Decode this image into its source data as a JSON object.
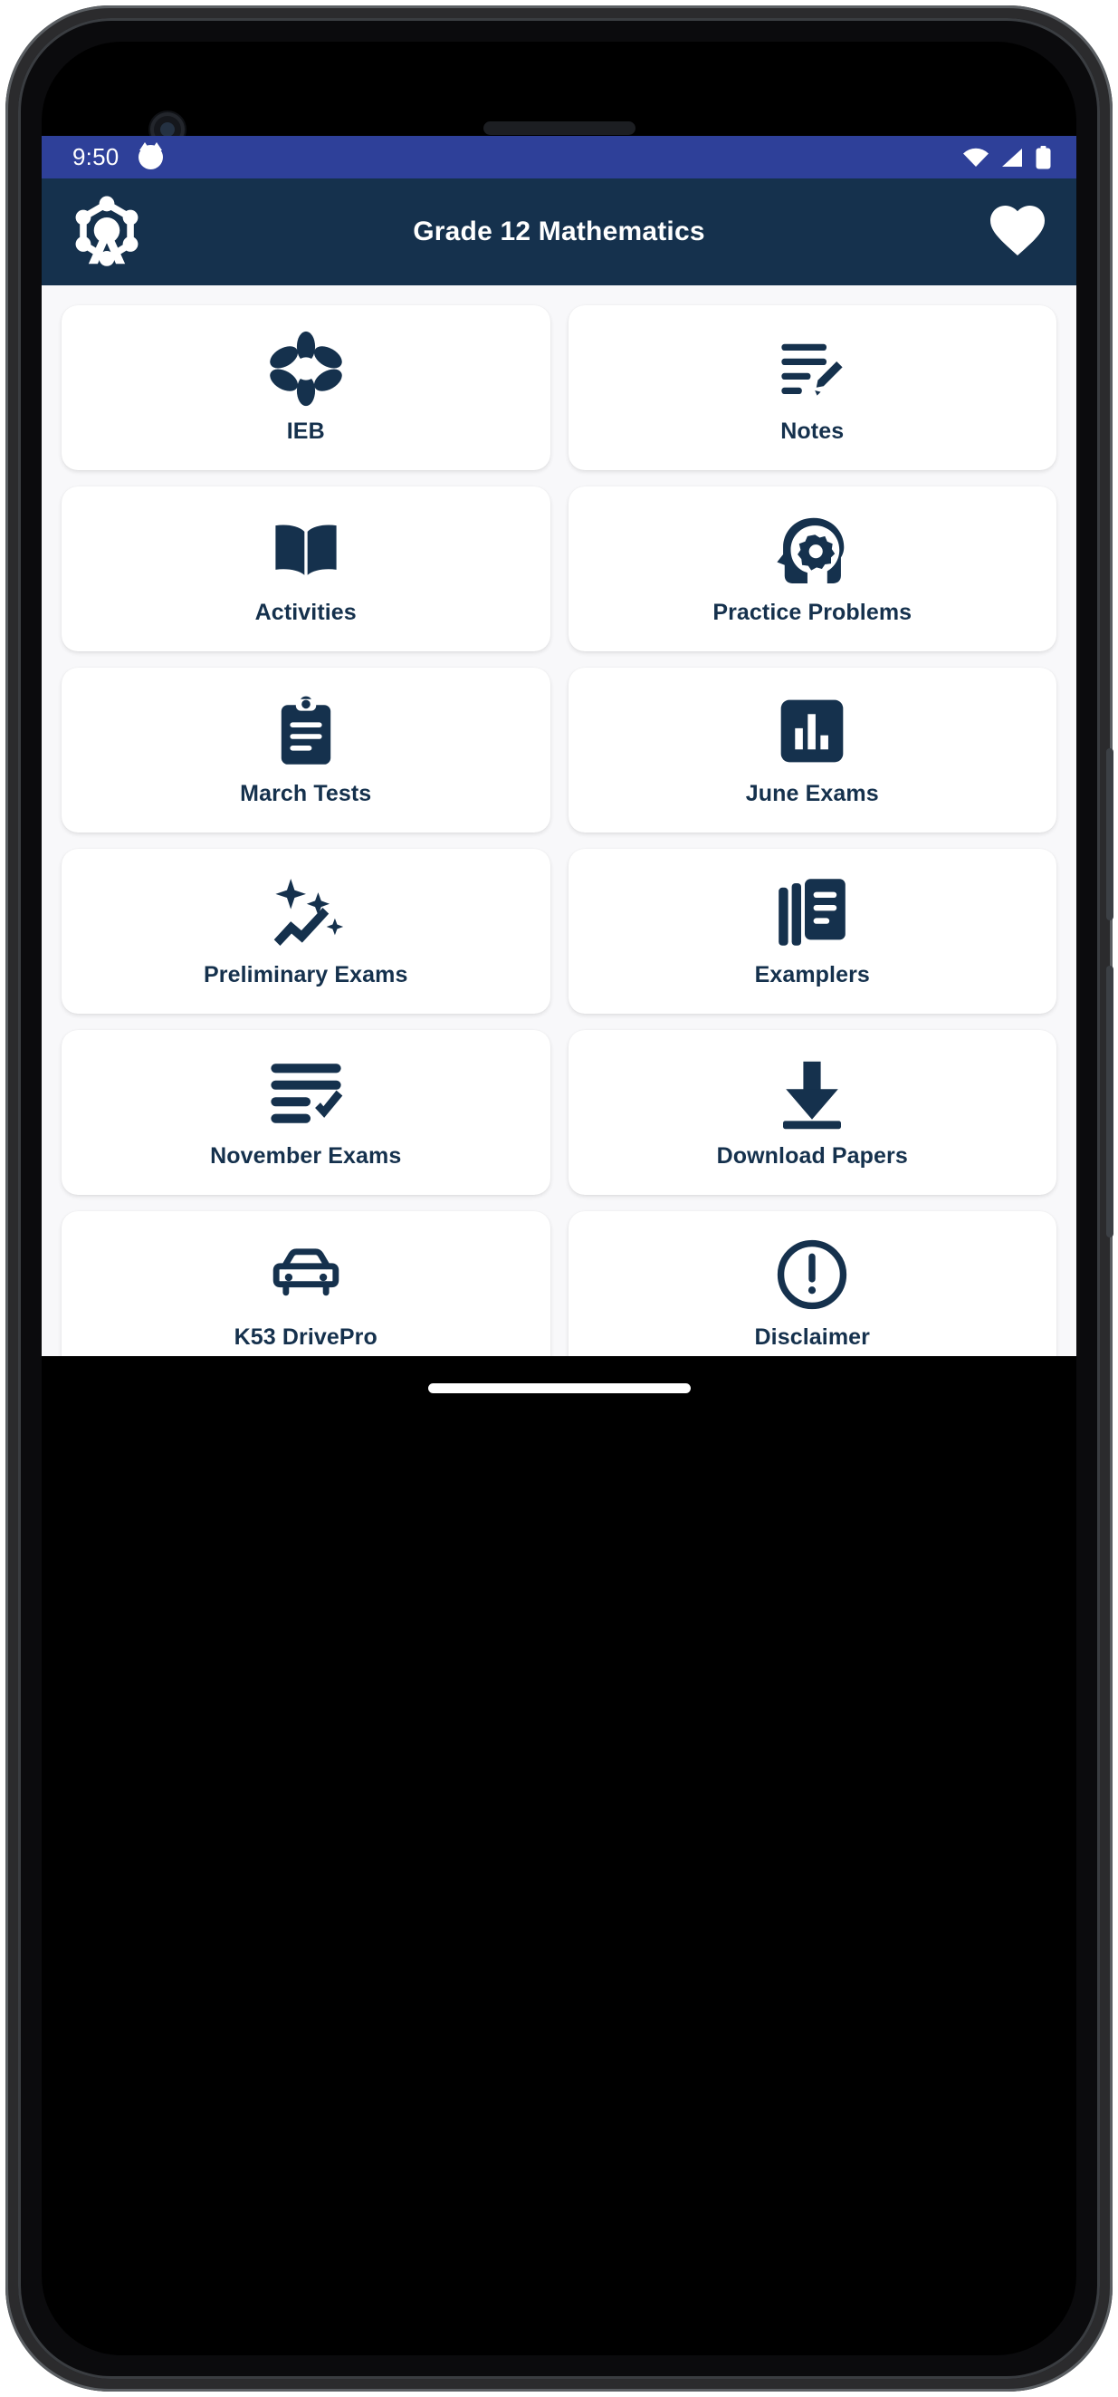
{
  "status_bar": {
    "time": "9:50",
    "app_icon": "cat-notification-icon",
    "icons": [
      "wifi-icon",
      "signal-icon",
      "battery-icon"
    ],
    "background_color": "#2e4099"
  },
  "app_bar": {
    "logo_icon": "ferris-wheel-logo-icon",
    "title": "Grade 12 Mathematics",
    "favorite_icon": "heart-filled-icon",
    "background_color": "#15314d"
  },
  "theme": {
    "navy": "#15314d",
    "status_blue": "#2e4099",
    "page_background": "#f8f8fa",
    "card_background": "#ffffff"
  },
  "grid": {
    "items": [
      {
        "label": "IEB",
        "icon": "flower-icon"
      },
      {
        "label": "Notes",
        "icon": "notes-pencil-icon"
      },
      {
        "label": "Activities",
        "icon": "open-book-icon"
      },
      {
        "label": "Practice Problems",
        "icon": "head-gear-icon"
      },
      {
        "label": "March Tests",
        "icon": "clipboard-icon"
      },
      {
        "label": "June Exams",
        "icon": "bar-chart-icon"
      },
      {
        "label": "Preliminary Exams",
        "icon": "sparkle-trend-icon"
      },
      {
        "label": "Examplers",
        "icon": "documents-stack-icon"
      },
      {
        "label": "November Exams",
        "icon": "checklist-icon"
      },
      {
        "label": "Download Papers",
        "icon": "download-icon"
      },
      {
        "label": "K53 DrivePro",
        "icon": "car-icon"
      },
      {
        "label": "Disclaimer",
        "icon": "exclamation-circle-icon"
      }
    ]
  },
  "navigation": {
    "gesture_pill": "home-gesture-pill"
  }
}
